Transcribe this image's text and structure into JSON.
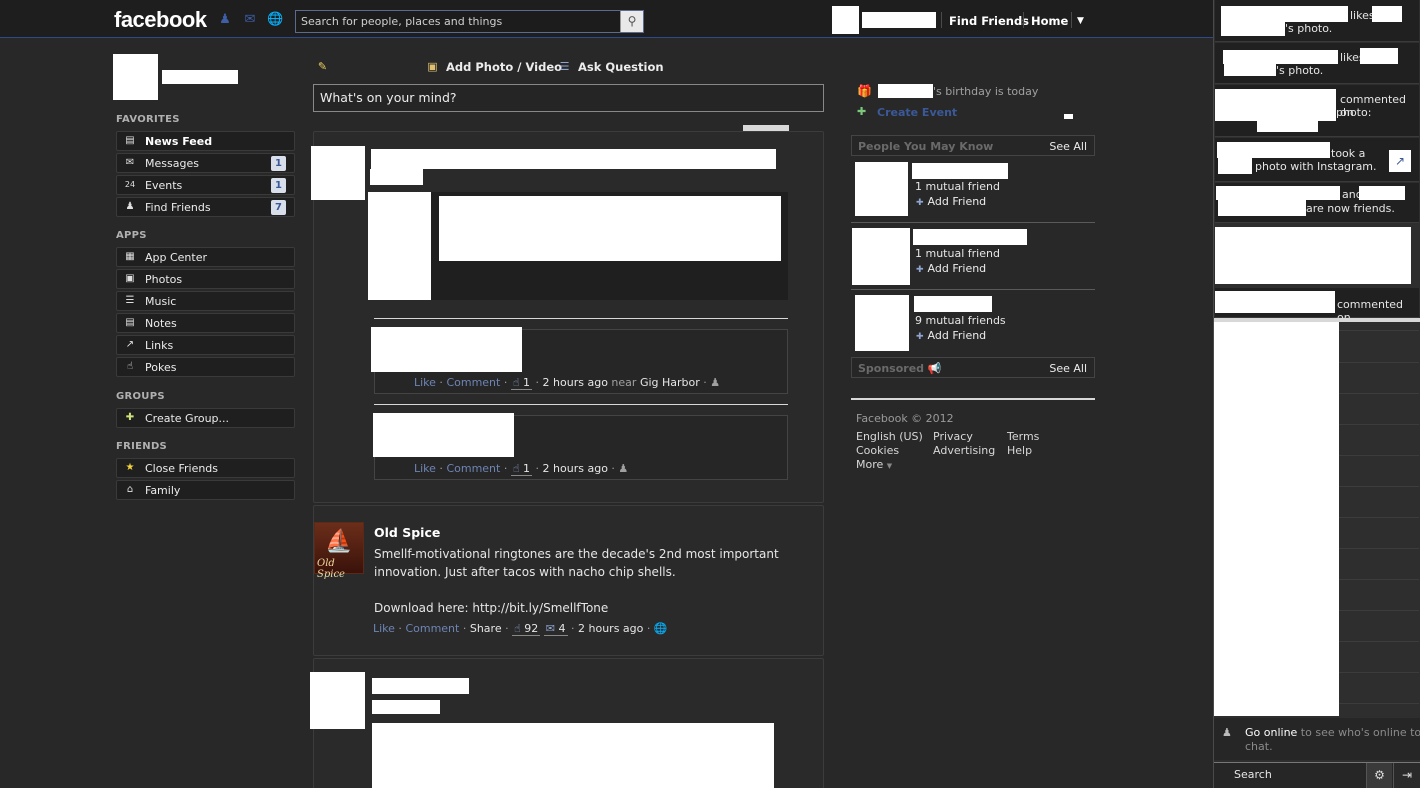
{
  "topbar": {
    "logo": "facebook",
    "search_placeholder": "Search for people, places and things",
    "find_friends": "Find Friends",
    "home": "Home"
  },
  "left_nav": {
    "favorites_head": "FAVORITES",
    "favorites": [
      {
        "label": "News Feed",
        "count": ""
      },
      {
        "label": "Messages",
        "count": "1"
      },
      {
        "label": "Events",
        "count": "1"
      },
      {
        "label": "Find Friends",
        "count": "7"
      }
    ],
    "apps_head": "APPS",
    "apps": [
      {
        "label": "App Center"
      },
      {
        "label": "Photos"
      },
      {
        "label": "Music"
      },
      {
        "label": "Notes"
      },
      {
        "label": "Links"
      },
      {
        "label": "Pokes"
      }
    ],
    "groups_head": "GROUPS",
    "groups": [
      {
        "label": "Create Group..."
      }
    ],
    "friends_head": "FRIENDS",
    "friends": [
      {
        "label": "Close Friends"
      },
      {
        "label": "Family"
      }
    ]
  },
  "composer": {
    "add_photo": "Add Photo / Video",
    "ask_question": "Ask Question",
    "status_placeholder": "What's on your mind?"
  },
  "feed": {
    "story1": {
      "comment1": {
        "like": "Like",
        "comment": "Comment",
        "likes": "1",
        "time": "2 hours ago",
        "near": "near",
        "place": "Gig Harbor"
      },
      "comment2": {
        "like": "Like",
        "comment": "Comment",
        "likes": "1",
        "time": "2 hours ago"
      }
    },
    "story2": {
      "name": "Old Spice",
      "text1": "Smellf-motivational ringtones are the decade's 2nd most important",
      "text2": "innovation. Just after tacos with nacho chip shells.",
      "text3": "Download here: http://bit.ly/SmellfTone",
      "logo_text": "Old Spice",
      "like": "Like",
      "comment": "Comment",
      "share": "Share",
      "likes": "92",
      "comments": "4",
      "time": "2 hours ago"
    }
  },
  "right_col": {
    "birthday_suffix": "'s birthday is today",
    "create_event": "Create Event",
    "pymk_head": "People You May Know",
    "see_all": "See All",
    "pymk": [
      {
        "mutual": "1 mutual friend",
        "add": "Add Friend"
      },
      {
        "mutual": "1 mutual friend",
        "add": "Add Friend"
      },
      {
        "mutual": "9 mutual friends",
        "add": "Add Friend"
      }
    ],
    "sponsored_head": "Sponsored",
    "footer": {
      "copyright": "Facebook © 2012",
      "english": "English (US)",
      "privacy": "Privacy",
      "terms": "Terms",
      "cookies": "Cookies",
      "advertising": "Advertising",
      "help": "Help",
      "more": "More"
    }
  },
  "ticker": {
    "t1a": "likes",
    "t1b": "'s photo.",
    "t2a": "likes",
    "t2b": "'s photo.",
    "t3a": "commented on",
    "t3b": "photo:",
    "t4a": "took a",
    "t4b": "photo with Instagram.",
    "t5a": "and",
    "t5b": "are now friends.",
    "t6a": "commented on"
  },
  "chat": {
    "go_online": "Go online",
    "go_online_rest1": " to see who's online to",
    "go_online_rest2": "chat.",
    "search": "Search"
  }
}
